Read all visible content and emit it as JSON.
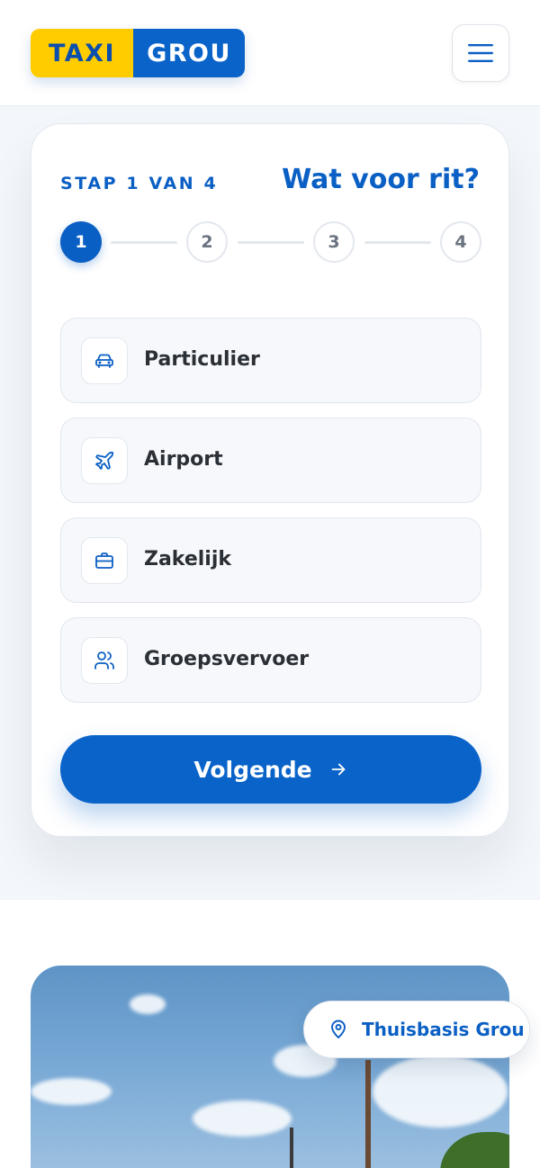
{
  "header": {
    "logo_left": "TAXI",
    "logo_right": "GROU",
    "menu_icon": "hamburger-icon"
  },
  "booking": {
    "step_label": "STAP 1 VAN 4",
    "title": "Wat voor rit?",
    "steps": [
      "1",
      "2",
      "3",
      "4"
    ],
    "current_step": 1,
    "options": [
      {
        "label": "Particulier",
        "icon": "car-icon"
      },
      {
        "label": "Airport",
        "icon": "plane-icon"
      },
      {
        "label": "Zakelijk",
        "icon": "briefcase-icon"
      },
      {
        "label": "Groepsvervoer",
        "icon": "users-icon"
      }
    ],
    "next_label": "Volgende",
    "next_icon": "arrow-right-icon"
  },
  "location": {
    "label": "Thuisbasis Grou",
    "icon": "map-pin-icon"
  },
  "colors": {
    "primary": "#0a63c9",
    "accent": "#ffcc00"
  }
}
